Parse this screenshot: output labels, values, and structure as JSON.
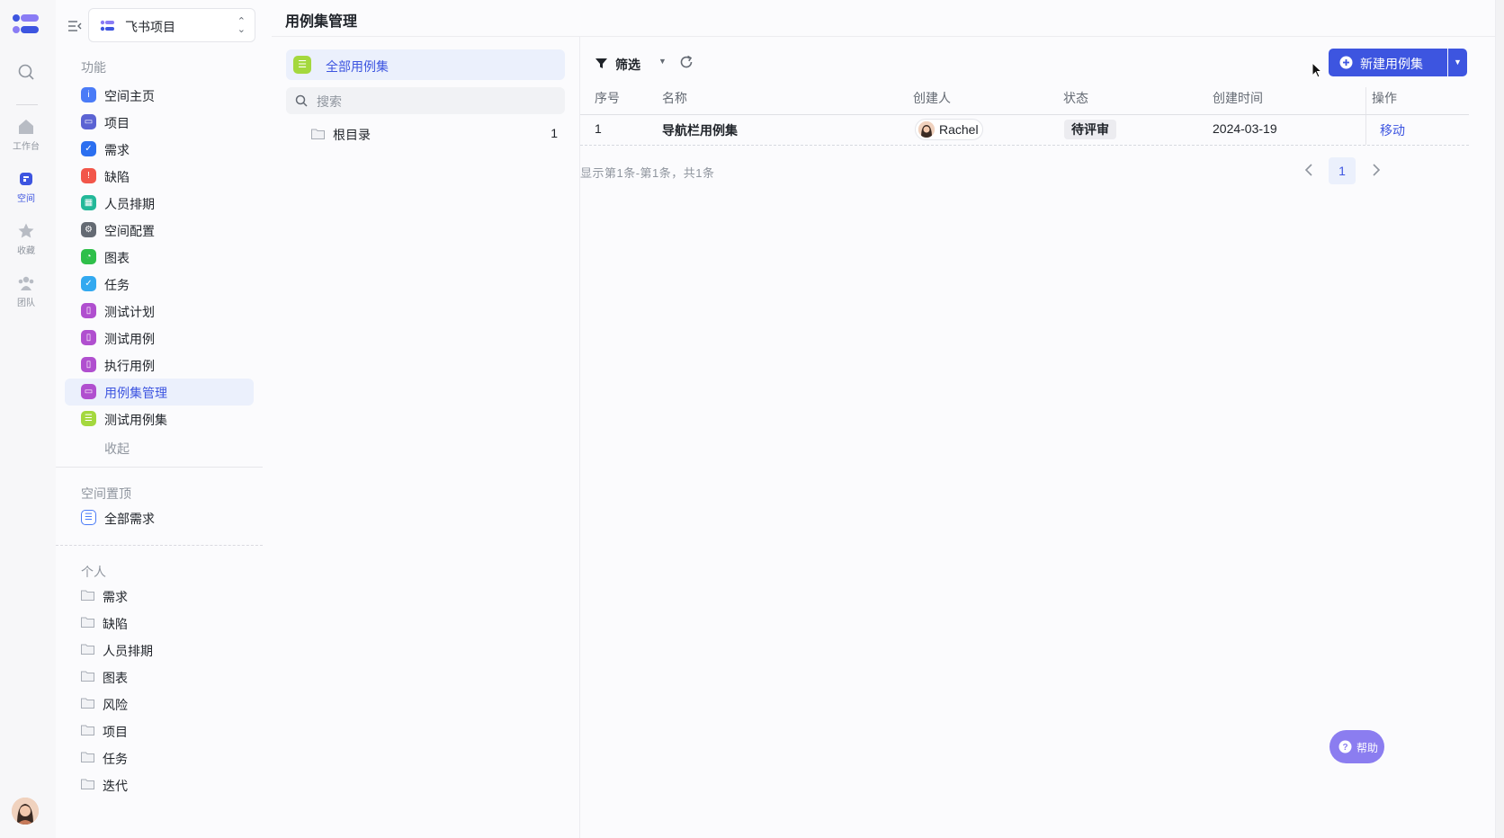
{
  "rail": {
    "items": [
      {
        "label": "",
        "icon": "search-icon"
      },
      {
        "label": "工作台",
        "icon": "home-icon"
      },
      {
        "label": "空间",
        "icon": "space-icon"
      },
      {
        "label": "收藏",
        "icon": "star-icon"
      },
      {
        "label": "团队",
        "icon": "team-icon"
      }
    ]
  },
  "nav": {
    "project_name": "飞书项目",
    "section_functions": "功能",
    "items": [
      {
        "label": "空间主页",
        "color": "#4a7bf7"
      },
      {
        "label": "项目",
        "color": "#5b63d3"
      },
      {
        "label": "需求",
        "color": "#2b6ff0"
      },
      {
        "label": "缺陷",
        "color": "#f2564a"
      },
      {
        "label": "人员排期",
        "color": "#23b899"
      },
      {
        "label": "空间配置",
        "color": "#646a73"
      },
      {
        "label": "图表",
        "color": "#2fbf4a"
      },
      {
        "label": "任务",
        "color": "#33a9f0"
      },
      {
        "label": "测试计划",
        "color": "#b04fcf"
      },
      {
        "label": "测试用例",
        "color": "#b04fcf"
      },
      {
        "label": "执行用例",
        "color": "#b04fcf"
      },
      {
        "label": "用例集管理",
        "color": "#b04fcf"
      },
      {
        "label": "测试用例集",
        "color": "#a4d83e"
      }
    ],
    "collapse_label": "收起",
    "section_pinned": "空间置顶",
    "pinned_items": [
      {
        "label": "全部需求"
      }
    ],
    "section_personal": "个人",
    "personal_items": [
      {
        "label": "需求"
      },
      {
        "label": "缺陷"
      },
      {
        "label": "人员排期"
      },
      {
        "label": "图表"
      },
      {
        "label": "风险"
      },
      {
        "label": "项目"
      },
      {
        "label": "任务"
      },
      {
        "label": "迭代"
      }
    ]
  },
  "header": {
    "title": "用例集管理"
  },
  "tree": {
    "all_label": "全部用例集",
    "search_placeholder": "搜索",
    "nodes": [
      {
        "label": "根目录",
        "count": "1"
      }
    ]
  },
  "toolbar": {
    "filter_label": "筛选",
    "new_button_label": "新建用例集"
  },
  "table": {
    "columns": [
      "序号",
      "名称",
      "创建人",
      "状态",
      "创建时间",
      "操作"
    ],
    "rows": [
      {
        "index": "1",
        "name": "导航栏用例集",
        "creator": "Rachel",
        "status": "待评审",
        "created": "2024-03-19",
        "action": "移动"
      }
    ],
    "summary": "显示第1条-第1条，共1条",
    "current_page": "1"
  },
  "help": {
    "label": "帮助"
  },
  "colors": {
    "accent": "#3d55e0",
    "help_bg": "#8b7df0"
  }
}
